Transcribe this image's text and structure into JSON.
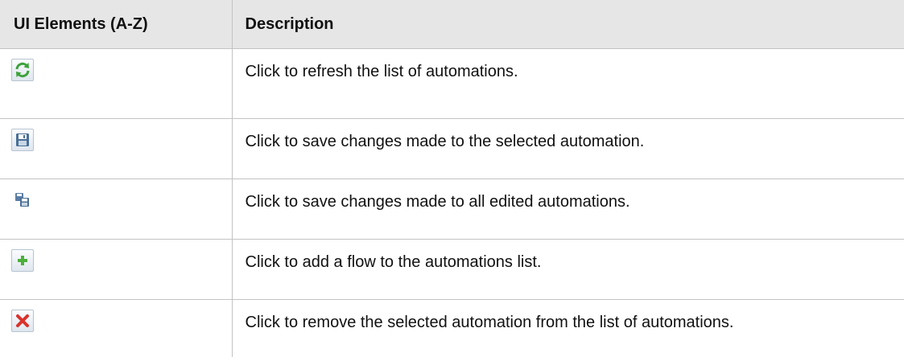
{
  "table": {
    "headers": {
      "ui_elements": "UI Elements (A-Z)",
      "description": "Description"
    },
    "rows": [
      {
        "icon": "refresh-icon",
        "description": "Click to refresh the list of automations."
      },
      {
        "icon": "save-icon",
        "description": "Click to save changes made to the selected automation."
      },
      {
        "icon": "save-all-icon",
        "description": "Click to save changes made to all edited automations."
      },
      {
        "icon": "add-icon",
        "description": "Click to add a flow to the automations list."
      },
      {
        "icon": "remove-icon",
        "description": "Click to remove the selected automation from the list of automations."
      }
    ]
  },
  "colors": {
    "header_background": "#e6e6e6",
    "grid_line": "#c3c3c3",
    "refresh_green": "#3da23a",
    "save_blue": "#4a6e96",
    "add_green": "#4caf3c",
    "remove_red": "#d9322b"
  }
}
